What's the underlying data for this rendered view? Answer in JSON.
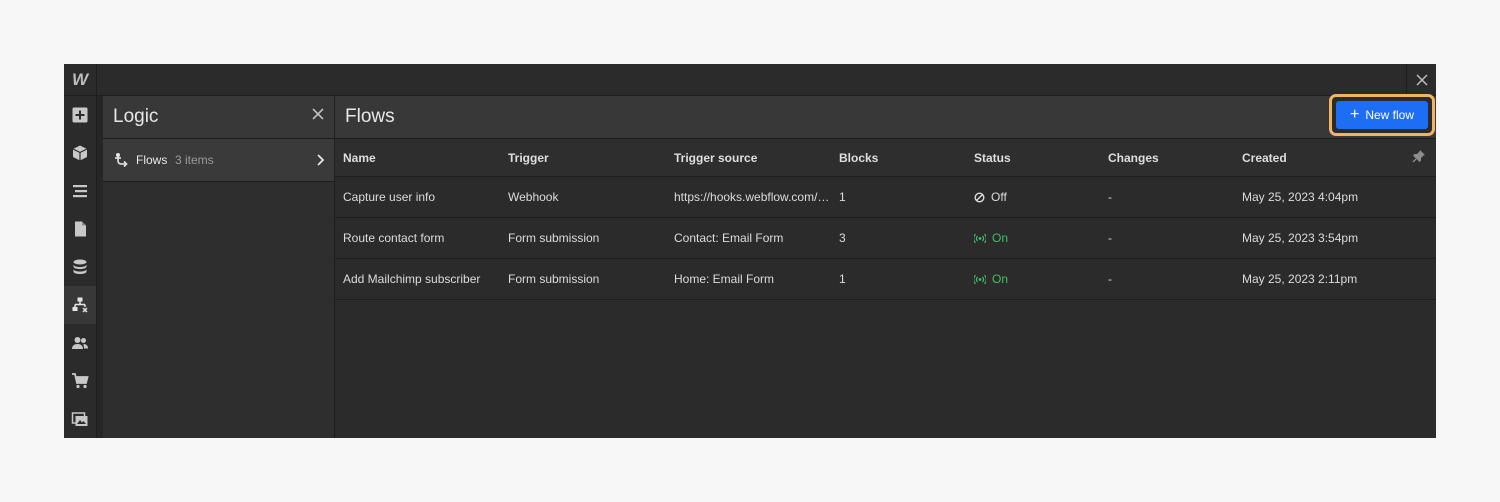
{
  "app": {
    "logo_text": "W"
  },
  "rail_icons": [
    "add-icon",
    "box-icon",
    "navigator-icon",
    "pages-icon",
    "cms-icon",
    "logic-icon",
    "users-icon",
    "ecommerce-icon",
    "assets-icon"
  ],
  "logic_panel": {
    "title": "Logic",
    "item": {
      "label": "Flows",
      "count": "3 items"
    }
  },
  "main": {
    "title": "Flows",
    "new_flow_label": "New flow",
    "columns": [
      "Name",
      "Trigger",
      "Trigger source",
      "Blocks",
      "Status",
      "Changes",
      "Created"
    ],
    "rows": [
      {
        "name": "Capture user info",
        "trigger": "Webhook",
        "source": "https://hooks.webflow.com/lo...",
        "blocks": "1",
        "status": "Off",
        "changes": "-",
        "created": "May 25, 2023 4:04pm"
      },
      {
        "name": "Route contact form",
        "trigger": "Form submission",
        "source": "Contact: Email Form",
        "blocks": "3",
        "status": "On",
        "changes": "-",
        "created": "May 25, 2023 3:54pm"
      },
      {
        "name": "Add Mailchimp subscriber",
        "trigger": "Form submission",
        "source": "Home: Email Form",
        "blocks": "1",
        "status": "On",
        "changes": "-",
        "created": "May 25, 2023 2:11pm"
      }
    ]
  },
  "colors": {
    "accent": "#1d6ef5",
    "highlight": "#f0b463",
    "on": "#3fc06b"
  }
}
